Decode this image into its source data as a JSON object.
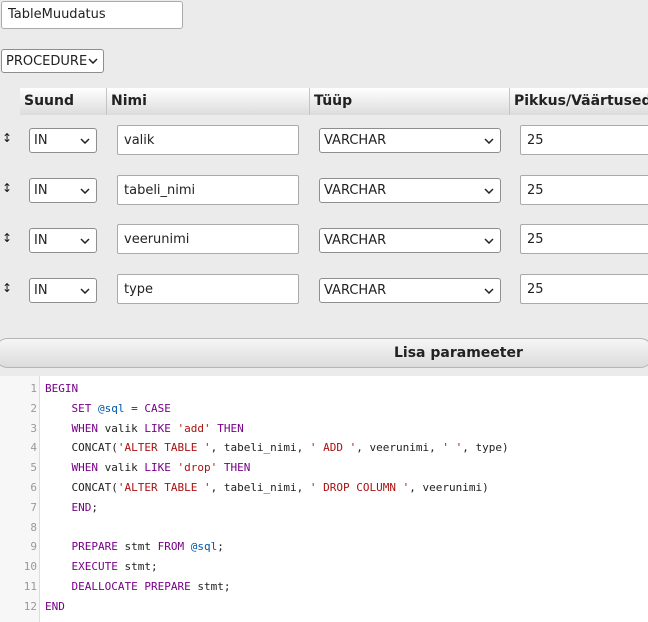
{
  "routine_name": "TableMuudatus",
  "routine_type": "PROCEDURE",
  "params_header": {
    "direction": "Suund",
    "name": "Nimi",
    "type": "Tüüp",
    "length": "Pikkus/Väärtused"
  },
  "params": [
    {
      "direction": "IN",
      "name": "valik",
      "type": "VARCHAR",
      "length": "25"
    },
    {
      "direction": "IN",
      "name": "tabeli_nimi",
      "type": "VARCHAR",
      "length": "25"
    },
    {
      "direction": "IN",
      "name": "veerunimi",
      "type": "VARCHAR",
      "length": "25"
    },
    {
      "direction": "IN",
      "name": "type",
      "type": "VARCHAR",
      "length": "25"
    }
  ],
  "add_param_label": "Lisa parameeter",
  "line_numbers": [
    "1",
    "2",
    "3",
    "4",
    "5",
    "6",
    "7",
    "8",
    "9",
    "10",
    "11",
    "12"
  ],
  "code": {
    "l1_begin": "BEGIN",
    "l2_set": "SET",
    "l2_var": "@sql",
    "l2_eq": "=",
    "l2_case": "CASE",
    "l3_when": "WHEN",
    "l3_a": "valik",
    "l3_like": "LIKE",
    "l3_str": "'add'",
    "l3_then": "THEN",
    "l4_fn": "CONCAT(",
    "l4_s1": "'ALTER TABLE '",
    "l4_a": ", tabeli_nimi, ",
    "l4_s2": "' ADD '",
    "l4_b": ", veerunimi, ",
    "l4_s3": "' '",
    "l4_c": ", type)",
    "l5_when": "WHEN",
    "l5_a": "valik",
    "l5_like": "LIKE",
    "l5_str": "'drop'",
    "l5_then": "THEN",
    "l6_fn": "CONCAT(",
    "l6_s1": "'ALTER TABLE '",
    "l6_a": ", tabeli_nimi, ",
    "l6_s2": "' DROP COLUMN '",
    "l6_b": ", veerunimi)",
    "l7_end": "END",
    "l7_semi": ";",
    "l9_prepare": "PREPARE",
    "l9_a": "stmt",
    "l9_from": "FROM",
    "l9_var": "@sql",
    "l9_semi": ";",
    "l10_exec": "EXECUTE",
    "l10_a": "stmt;",
    "l11_deal": "DEALLOCATE PREPARE",
    "l11_a": "stmt;",
    "l12_end": "END"
  }
}
